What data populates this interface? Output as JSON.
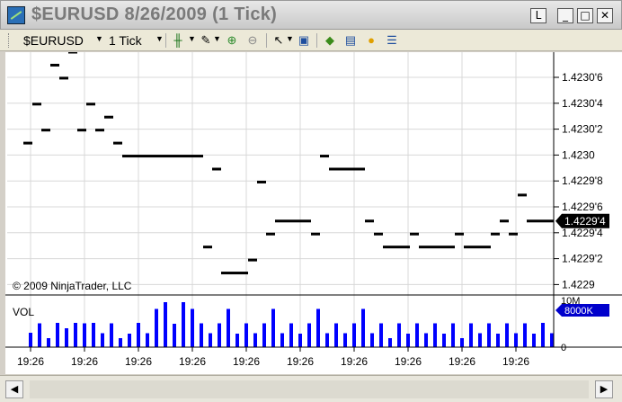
{
  "window": {
    "title": "$EURUSD  8/26/2009 (1 Tick)",
    "buttons": {
      "link": "L",
      "minimize": "_",
      "maximize": "□",
      "close": "✕"
    }
  },
  "toolbar": {
    "instrument": "$EURUSD",
    "interval": "1 Tick",
    "icons": [
      "candlestick-icon",
      "pencil-icon",
      "zoom-in-icon",
      "zoom-out-icon",
      "cursor-icon",
      "properties-icon",
      "strategy-icon",
      "indicator-icon",
      "currency-icon",
      "data-box-icon"
    ]
  },
  "chart": {
    "copyright": "© 2009 NinjaTrader, LLC",
    "price_labels": [
      "1.4230'6",
      "1.4230'4",
      "1.4230'2",
      "1.4230",
      "1.4229'8",
      "1.4229'6",
      "1.4229'4",
      "1.4229'2",
      "1.4229"
    ],
    "last_price": "1.4229'4",
    "volume_label": "VOL",
    "volume_axis_top": "10M",
    "volume_axis_bottom": "0",
    "volume_marker": "8000K",
    "time_labels": [
      "19:26",
      "19:26",
      "19:26",
      "19:26",
      "19:26",
      "19:26",
      "19:26",
      "19:26",
      "19:26",
      "19:26"
    ],
    "colors": {
      "price_bar": "#000000",
      "volume_bar": "#0000ff",
      "marker_bg": "#000000",
      "volume_marker_bg": "#0000cc"
    }
  },
  "chart_data": {
    "type": "bar",
    "price_series": {
      "name": "$EURUSD",
      "ylim": [
        1.42289,
        1.42307
      ],
      "values": [
        1.423,
        1.42303,
        1.42301,
        1.42306,
        1.42305,
        1.42307,
        1.42301,
        1.42303,
        1.42301,
        1.42302,
        1.423,
        1.42299,
        1.42299,
        1.42299,
        1.42299,
        1.42299,
        1.42299,
        1.42299,
        1.42299,
        1.42299,
        1.42292,
        1.42298,
        1.4229,
        1.4229,
        1.4229,
        1.42291,
        1.42297,
        1.42293,
        1.42294,
        1.42294,
        1.42294,
        1.42294,
        1.42293,
        1.42299,
        1.42298,
        1.42298,
        1.42298,
        1.42298,
        1.42294,
        1.42293,
        1.42292,
        1.42292,
        1.42292,
        1.42293,
        1.42292,
        1.42292,
        1.42292,
        1.42292,
        1.42293,
        1.42292,
        1.42292,
        1.42292,
        1.42293,
        1.42294,
        1.42293,
        1.42296,
        1.42294,
        1.42294,
        1.42294,
        1.42294,
        1.42294,
        1.42294
      ]
    },
    "volume_series": {
      "name": "VOL",
      "ylim": [
        0,
        10000000
      ],
      "values": [
        3200000,
        5300000,
        2000000,
        5400000,
        4200000,
        5400000,
        5300000,
        5400000,
        3100000,
        5300000,
        2000000,
        3000000,
        5400000,
        3100000,
        8500000,
        10000000,
        5200000,
        10000000,
        8500000,
        5300000,
        3100000,
        5300000,
        8500000,
        3000000,
        5300000,
        3100000,
        5300000,
        8500000,
        3100000,
        5300000,
        3000000,
        5300000,
        8500000,
        3100000,
        5300000,
        3100000,
        5300000,
        8500000,
        3100000,
        5300000,
        2000000,
        5300000,
        3000000,
        5300000,
        3100000,
        5300000,
        3000000,
        5300000,
        2000000,
        5300000,
        3100000,
        5300000,
        3000000,
        5300000,
        3100000,
        5300000,
        3000000,
        5400000,
        3100000,
        5300000,
        8500000,
        3100000
      ]
    },
    "x_tick_labels": [
      "19:26",
      "19:26",
      "19:26",
      "19:26",
      "19:26",
      "19:26",
      "19:26",
      "19:26",
      "19:26",
      "19:26"
    ]
  }
}
